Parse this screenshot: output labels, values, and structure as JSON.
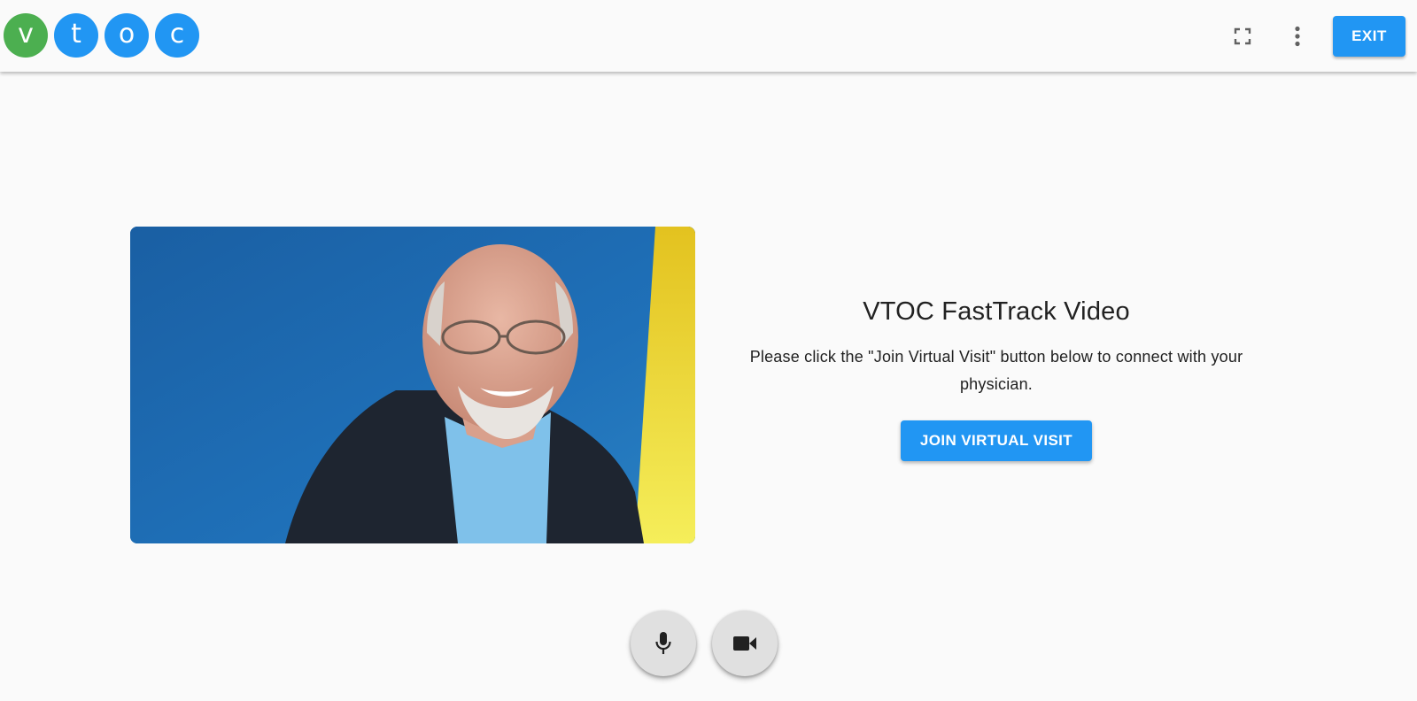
{
  "header": {
    "logo_letters": [
      "v",
      "t",
      "o",
      "c"
    ],
    "logo_colors": [
      "#4caf50",
      "#2196f3",
      "#2196f3",
      "#2196f3"
    ],
    "fullscreen_icon": "fullscreen-icon",
    "more_icon": "more-vert-icon",
    "exit_label": "EXIT"
  },
  "main": {
    "video_preview_icon": "camera-preview",
    "title": "VTOC FastTrack Video",
    "description": "Please click the \"Join Virtual Visit\" button below to connect with your physician.",
    "join_label": "JOIN VIRTUAL VISIT"
  },
  "controls": {
    "mic_icon": "microphone-icon",
    "camera_icon": "videocam-icon"
  },
  "colors": {
    "accent": "#2196f3",
    "logo_green": "#4caf50",
    "background": "#fafafa",
    "fab": "#e0e0e0"
  }
}
